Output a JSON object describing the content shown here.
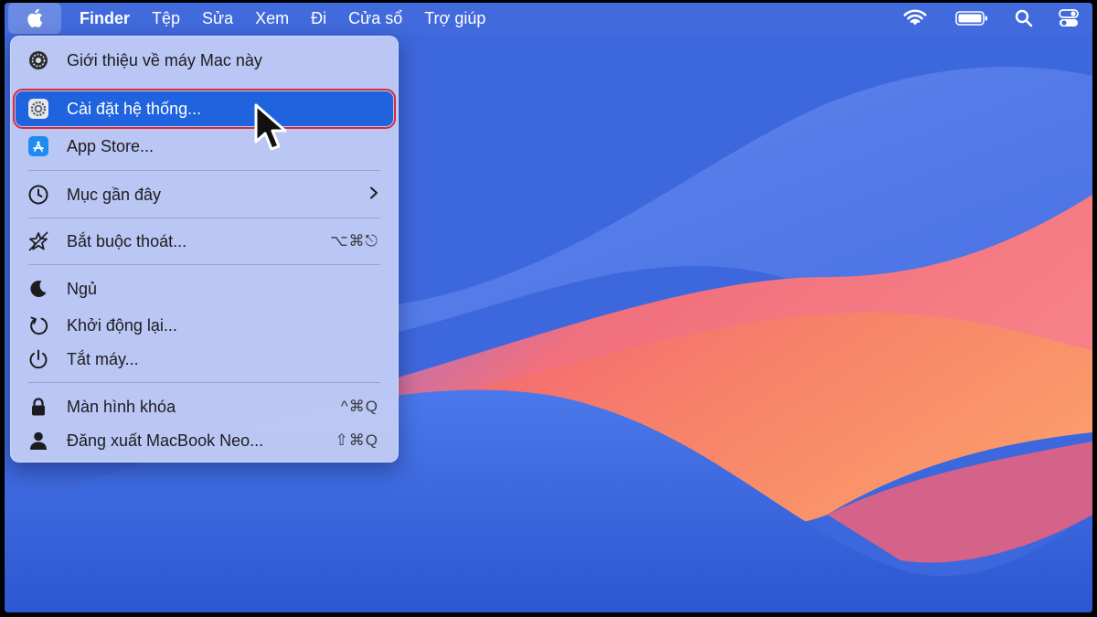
{
  "menubar": {
    "app_name": "Finder",
    "menus": [
      "Tệp",
      "Sửa",
      "Xem",
      "Đi",
      "Cửa sổ",
      "Trợ giúp"
    ],
    "status_icons": [
      "wifi-icon",
      "battery-icon",
      "spotlight-search-icon",
      "control-center-icon"
    ]
  },
  "apple_menu": {
    "items": [
      {
        "label": "Giới thiệu về máy Mac này",
        "icon": "about-mac-icon",
        "shortcut": ""
      },
      {
        "label": "Cài đặt hệ thống...",
        "icon": "system-settings-icon",
        "shortcut": "",
        "selected": true
      },
      {
        "label": "App Store...",
        "icon": "app-store-icon",
        "shortcut": ""
      },
      {
        "label": "Mục gần đây",
        "icon": "clock-icon",
        "shortcut": "",
        "submenu": true
      },
      {
        "label": "Bắt buộc thoát...",
        "icon": "force-quit-icon",
        "shortcut": "⌥⌘⎋"
      },
      {
        "label": "Ngủ",
        "icon": "moon-icon",
        "shortcut": ""
      },
      {
        "label": "Khởi động lại...",
        "icon": "restart-icon",
        "shortcut": ""
      },
      {
        "label": "Tắt máy...",
        "icon": "power-icon",
        "shortcut": ""
      },
      {
        "label": "Màn hình khóa",
        "icon": "lock-icon",
        "shortcut": "^⌘Q"
      },
      {
        "label": "Đăng xuất MacBook Neo...",
        "icon": "user-icon",
        "shortcut": "⇧⌘Q"
      }
    ]
  },
  "colors": {
    "highlight": "#1f63de",
    "annotation_outline": "#d62b3a",
    "menu_background": "#c4cef4"
  }
}
